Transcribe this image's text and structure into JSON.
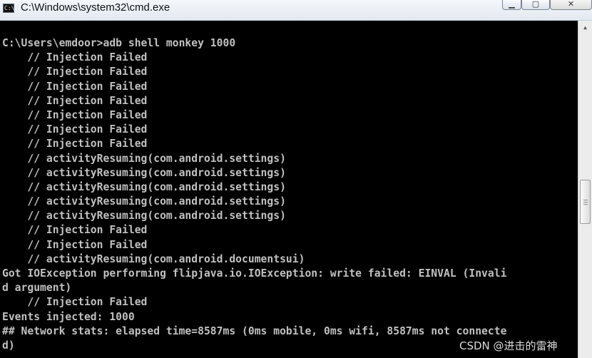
{
  "window": {
    "title": "C:\\Windows\\system32\\cmd.exe",
    "icon": "cmd-icon",
    "icon_text": "C:\\",
    "buttons": {
      "minimize": "minimize-icon",
      "maximize": "maximize-icon",
      "close": "close-icon"
    }
  },
  "colors": {
    "console_bg": "#000000",
    "console_text": "#c0c0c0"
  },
  "console": {
    "lines": [
      "C:\\Users\\emdoor>adb shell monkey 1000",
      "    // Injection Failed",
      "    // Injection Failed",
      "    // Injection Failed",
      "    // Injection Failed",
      "    // Injection Failed",
      "    // Injection Failed",
      "    // Injection Failed",
      "    // activityResuming(com.android.settings)",
      "    // activityResuming(com.android.settings)",
      "    // activityResuming(com.android.settings)",
      "    // activityResuming(com.android.settings)",
      "    // activityResuming(com.android.settings)",
      "    // Injection Failed",
      "    // Injection Failed",
      "    // activityResuming(com.android.documentsui)",
      "Got IOException performing flipjava.io.IOException: write failed: EINVAL (Invali",
      "d argument)",
      "    // Injection Failed",
      "Events injected: 1000",
      "## Network stats: elapsed time=8587ms (0ms mobile, 0ms wifi, 8587ms not connecte",
      "d)"
    ]
  },
  "scrollbar": {
    "up_arrow": "up-arrow-icon",
    "thumb_grip": "grip-icon"
  },
  "watermark": "CSDN @进击的雷神"
}
